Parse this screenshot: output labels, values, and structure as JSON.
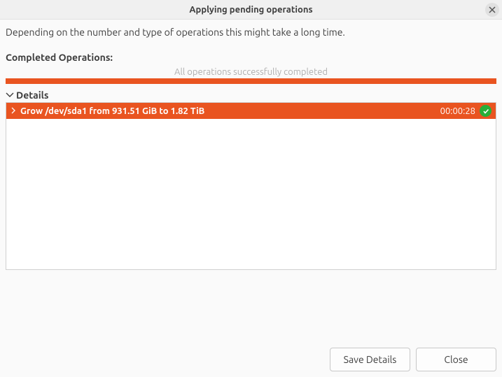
{
  "titlebar": {
    "title": "Applying pending operations"
  },
  "description": "Depending on the number and type of operations this might take a long time.",
  "completed_heading": "Completed Operations:",
  "status_message": "All operations successfully completed",
  "details": {
    "label": "Details"
  },
  "operations": [
    {
      "label": "Grow /dev/sda1 from 931.51 GiB to 1.82 TiB",
      "duration": "00:00:28",
      "status": "success"
    }
  ],
  "buttons": {
    "save_details": "Save Details",
    "close": "Close"
  }
}
